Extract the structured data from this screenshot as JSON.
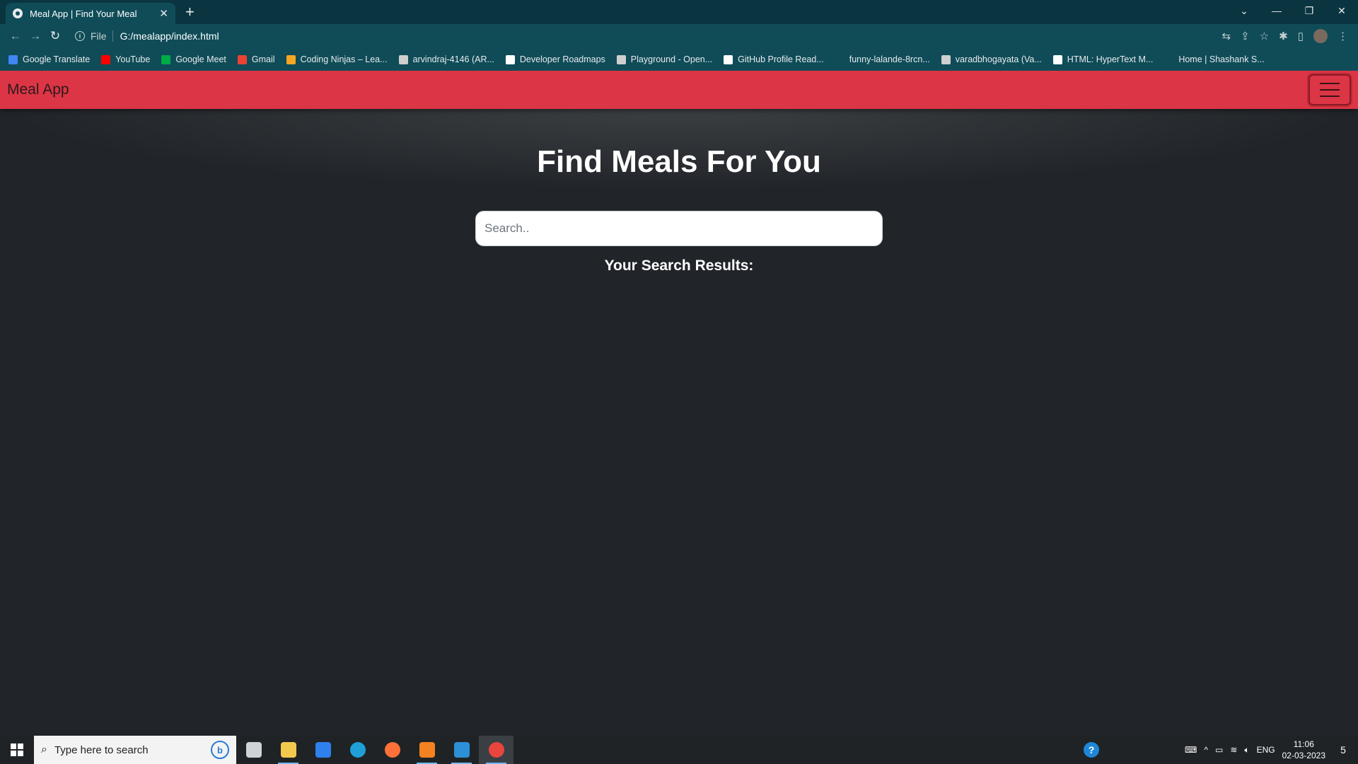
{
  "browser": {
    "tab_title": "Meal App | Find Your Meal",
    "tab_close": "✕",
    "new_tab": "+",
    "url_scheme": "File",
    "url": "G:/mealapp/index.html",
    "window_controls": {
      "collapse": "⌄",
      "minimize": "—",
      "restore": "❐",
      "close": "✕"
    },
    "nav": {
      "back": "←",
      "forward": "→",
      "reload": "↻"
    },
    "toolbar_icons": {
      "translate": "⇆",
      "share": "⇪",
      "bookmark": "☆",
      "extensions": "✱",
      "sidepanel": "▯",
      "menu": "⋮"
    },
    "bookmarks": [
      {
        "label": "Google Translate",
        "color": "#4285f4"
      },
      {
        "label": "YouTube",
        "color": "#ff0000"
      },
      {
        "label": "Google Meet",
        "color": "#00ac47"
      },
      {
        "label": "Gmail",
        "color": "#ea4335"
      },
      {
        "label": "Coding Ninjas – Lea...",
        "color": "#f5a623"
      },
      {
        "label": "arvindraj-4146 (AR...",
        "color": "#cfcfcf"
      },
      {
        "label": "Developer Roadmaps",
        "color": "#ffffff"
      },
      {
        "label": "Playground - Open...",
        "color": "#cfcfcf"
      },
      {
        "label": "GitHub Profile Read...",
        "color": "#ffffff"
      },
      {
        "label": "funny-lalande-8rcn...",
        "color": "#0f4c58"
      },
      {
        "label": "varadbhogayata (Va...",
        "color": "#cfcfcf"
      },
      {
        "label": "HTML: HyperText M...",
        "color": "#ffffff"
      },
      {
        "label": "Home | Shashank S...",
        "color": "#0f4c58"
      }
    ]
  },
  "app": {
    "brand": "Meal App",
    "heading": "Find Meals For You",
    "search_placeholder": "Search..",
    "results_heading": "Your Search Results:",
    "navbar_color": "#dc3545"
  },
  "taskbar": {
    "search_placeholder": "Type here to search",
    "search_icon": "⌕",
    "bing_label": "b",
    "apps": [
      {
        "name": "task-view",
        "color": "#cfd3d6"
      },
      {
        "name": "file-explorer",
        "color": "#f2c94c"
      },
      {
        "name": "microsoft-store",
        "color": "#2f80ed"
      },
      {
        "name": "edge",
        "color": "#1f9fd8"
      },
      {
        "name": "firefox",
        "color": "#ff7139"
      },
      {
        "name": "sublime-text",
        "color": "#f58220"
      },
      {
        "name": "vscode",
        "color": "#2d8fd5"
      },
      {
        "name": "chrome",
        "color": "#e8453c"
      }
    ],
    "help_label": "?",
    "tray_chevron": "^",
    "language": "ENG",
    "time": "11:06",
    "date": "02-03-2023",
    "notification_count": "5"
  }
}
